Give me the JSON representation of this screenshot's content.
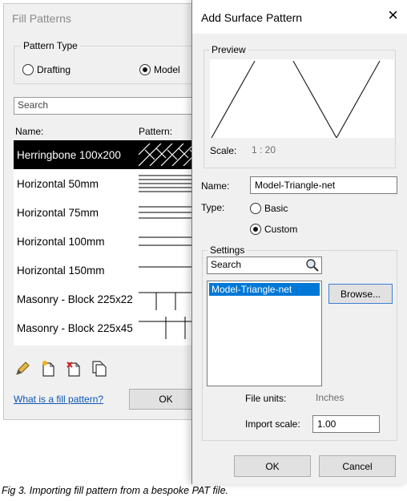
{
  "fill_patterns": {
    "title": "Fill Patterns",
    "pattern_type_label": "Pattern Type",
    "radio_drafting": "Drafting",
    "radio_model": "Model",
    "search_placeholder": "Search",
    "col_name": "Name:",
    "col_pattern": "Pattern:",
    "rows": [
      {
        "name": "Herringbone 100x200",
        "pattern": "herringbone"
      },
      {
        "name": "Horizontal  50mm",
        "pattern": "horizontal-50"
      },
      {
        "name": "Horizontal  75mm",
        "pattern": "horizontal-75"
      },
      {
        "name": "Horizontal 100mm",
        "pattern": "horizontal-100"
      },
      {
        "name": "Horizontal 150mm",
        "pattern": "horizontal-150"
      },
      {
        "name": "Masonry - Block 225x22",
        "pattern": "masonry-block"
      },
      {
        "name": "Masonry - Block 225x45",
        "pattern": "masonry-block"
      }
    ],
    "tool_icons": [
      "pencil-icon",
      "new-pattern-icon",
      "delete-pattern-icon",
      "duplicate-pattern-icon"
    ],
    "help_link": "What is a fill pattern?",
    "ok_label": "OK"
  },
  "add_surface_pattern": {
    "title": "Add Surface Pattern",
    "close_glyph": "×",
    "preview_label": "Preview",
    "scale_label": "Scale:",
    "scale_value": "1 : 20",
    "name_label": "Name:",
    "name_value": "Model-Triangle-net",
    "type_label": "Type:",
    "type_basic": "Basic",
    "type_custom": "Custom",
    "settings_label": "Settings",
    "search_placeholder": "Search",
    "file_item": "Model-Triangle-net",
    "browse_label": "Browse...",
    "file_units_label": "File units:",
    "file_units_value": "Inches",
    "import_scale_label": "Import scale:",
    "import_scale_value": "1.00",
    "ok_label": "OK",
    "cancel_label": "Cancel"
  },
  "caption": "Fig 3. Importing fill pattern from a bespoke PAT file."
}
